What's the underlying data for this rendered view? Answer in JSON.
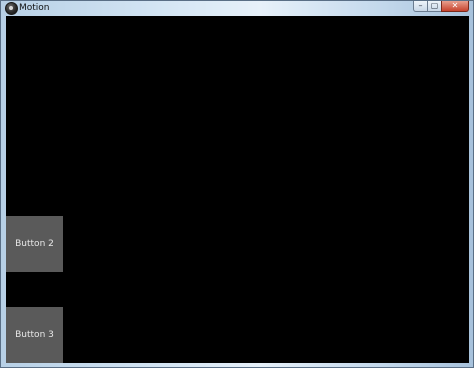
{
  "window": {
    "title": "Motion",
    "controls": {
      "minimize_glyph": "–",
      "maximize_glyph": "▢",
      "close_glyph": "✕"
    }
  },
  "canvas": {
    "background": "#000000",
    "buttons": [
      {
        "label": "Button 2"
      },
      {
        "label": "Button 3"
      }
    ]
  }
}
